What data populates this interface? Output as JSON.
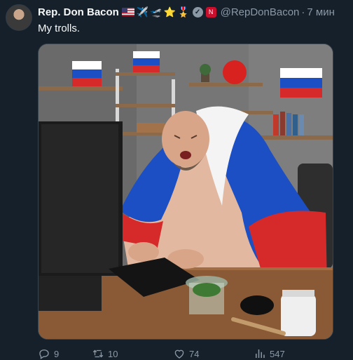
{
  "author": {
    "name": "Rep. Don Bacon",
    "handle": "@RepDonBacon",
    "time": "7 мин",
    "badges": [
      "🇺🇸",
      "✈️",
      "🛫",
      "⭐",
      "🎖️"
    ],
    "verified_icon": "verified-badge-icon",
    "affiliation_icon": "nebraska-n-icon"
  },
  "tweet": {
    "text": "My trolls."
  },
  "media": {
    "alt": ""
  },
  "actions": {
    "replies": "9",
    "retweets": "10",
    "likes": "74",
    "views": "547"
  },
  "colors": {
    "background": "#15202b",
    "secondary_text": "#8b98a5",
    "border": "#38444d"
  }
}
